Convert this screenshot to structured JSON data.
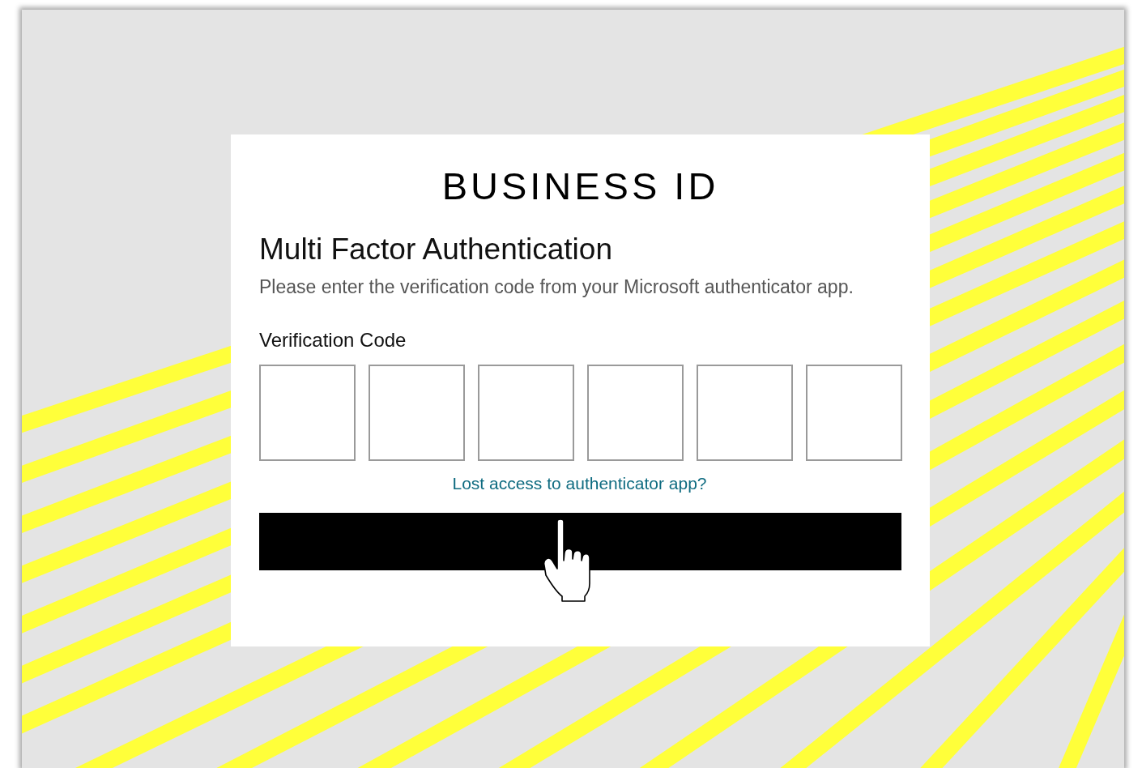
{
  "brand": {
    "title": "BUSINESS ID"
  },
  "heading": "Multi Factor Authentication",
  "description": "Please enter the verification code from your Microsoft authenticator app.",
  "code_field": {
    "label": "Verification Code",
    "boxes": [
      {
        "kind": "digit"
      },
      {
        "kind": "digit"
      },
      {
        "kind": "digit"
      },
      {
        "kind": "digit"
      },
      {
        "kind": "digit"
      },
      {
        "kind": "digit"
      }
    ]
  },
  "link": "Lost access to authenticator app?",
  "submit_button": {
    "kind": "primary"
  }
}
